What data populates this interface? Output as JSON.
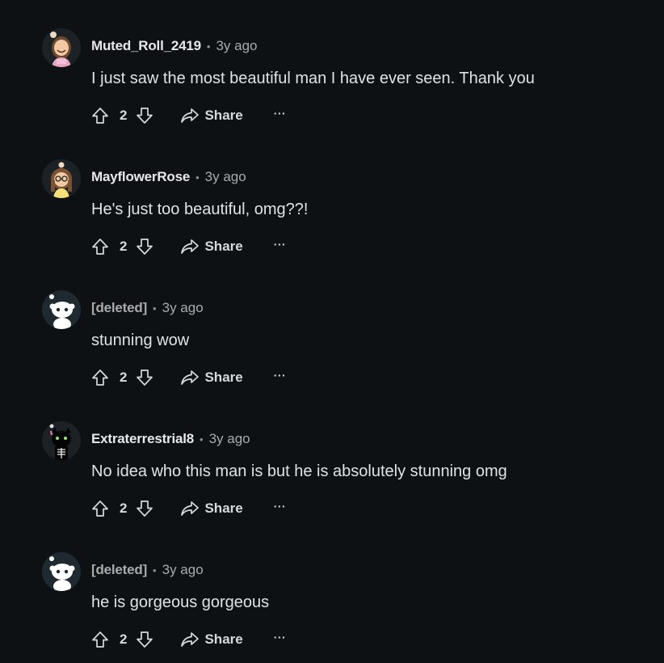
{
  "comments": [
    {
      "username": "Muted_Roll_2419",
      "deleted": false,
      "avatar": "smiling-girl-avatar",
      "separator": "•",
      "time": "3y ago",
      "body": "I just saw the most beautiful man I have ever seen. Thank you",
      "score": "2",
      "share_label": "Share",
      "more_label": "···"
    },
    {
      "username": "MayflowerRose",
      "deleted": false,
      "avatar": "glasses-girl-avatar",
      "separator": "•",
      "time": "3y ago",
      "body": "He's just too beautiful, omg??!",
      "score": "2",
      "share_label": "Share",
      "more_label": "···"
    },
    {
      "username": "[deleted]",
      "deleted": true,
      "avatar": "default-snoo-avatar",
      "separator": "•",
      "time": "3y ago",
      "body": "stunning wow",
      "score": "2",
      "share_label": "Share",
      "more_label": "···"
    },
    {
      "username": "Extraterrestrial8",
      "deleted": false,
      "avatar": "black-cat-skeleton-avatar",
      "separator": "•",
      "time": "3y ago",
      "body": "No idea who this man is but he is absolutely stunning omg",
      "score": "2",
      "share_label": "Share",
      "more_label": "···"
    },
    {
      "username": "[deleted]",
      "deleted": true,
      "avatar": "default-snoo-avatar",
      "separator": "•",
      "time": "3y ago",
      "body": "he is gorgeous gorgeous",
      "score": "2",
      "share_label": "Share",
      "more_label": "···"
    }
  ],
  "colors": {
    "background": "#0e1113",
    "text": "#d7dadc",
    "muted": "#a8aaab"
  }
}
